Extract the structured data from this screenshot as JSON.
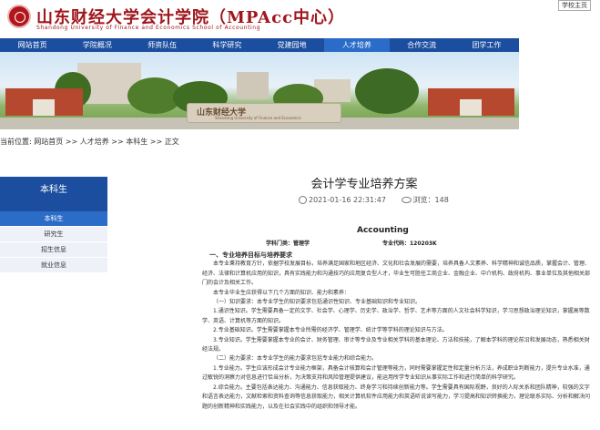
{
  "header": {
    "title": "山东财经大学会计学院（MPAcc中心）",
    "subtitle": "Shandong University of Finance and Economics School of Accounting",
    "top_link": "学校主页"
  },
  "nav": [
    "网站首页",
    "学院概况",
    "师资队伍",
    "科学研究",
    "党建园地",
    "人才培养",
    "合作交流",
    "团学工作"
  ],
  "banner": {
    "stone_text": "山东财经大学",
    "stone_sub": "Shandong University of Finance and Economics"
  },
  "breadcrumb": "当前位置: 网站首页 >> 人才培养 >> 本科生 >> 正文",
  "sidebar": {
    "title": "本科生",
    "items": [
      "本科生",
      "研究生",
      "招生信息",
      "就业信息"
    ]
  },
  "article": {
    "title": "会计学专业培养方案",
    "date": "2021-01-16 22:31:47",
    "views_label": "浏览：",
    "views": "148",
    "heading": "Accounting",
    "subject": "学科门类：管理学",
    "code": "专业代码：120203K",
    "paragraphs": [
      {
        "type": "h",
        "text": "一、专业培养目标与培养要求"
      },
      {
        "type": "p",
        "text": "本专业秉持教育方针，依据学校发展目标，培养满足国家和地区经济、文化和社会发展的需要，培养具备人文素养、科学精神和诚信品质，掌握会计、管理、经济、法律和计算机应用的知识，具有实践能力和沟通技巧的应用复合型人才，毕业生可胜任工商企业、金融企业、中介机构、政府机构、事业单位及其他相关部门的会计及相关工作。"
      },
      {
        "type": "p",
        "text": "本专业毕业生应获得以下几个方面的知识、能力和素养："
      },
      {
        "type": "p",
        "text": "（一）知识要求：本专业学生的知识要求包括通识性知识、专业基础知识和专业知识。"
      },
      {
        "type": "p",
        "text": "1.通识性知识。学生需要具备一定的文学、社会学、心理学、历史学、政治学、哲学、艺术等方面的人文社会科学知识，学习思想政治理论知识，掌握高等数学、英语、计算机等方面的知识。"
      },
      {
        "type": "p",
        "text": "2.专业基础知识。学生需要掌握本专业所需的经济学、管理学、统计学等学科的理论知识与方法。"
      },
      {
        "type": "p",
        "text": "3.专业知识。学生需要掌握本专业的会计、财务管理、审计等专业及专业相关学科的基本理论、方法和技能，了解本学科的理论前沿和发展动态，熟悉相关财经法规。"
      },
      {
        "type": "p",
        "text": "（二）能力要求：本专业学生的能力要求包括专业能力和综合能力。"
      },
      {
        "type": "p",
        "text": "1.专业能力。学生应该形成会计专业能力框架，具备会计核算和会计管理等能力，同时需要掌握定性和定量分析方法，养成职业判断能力，提升专业水准，通过敏锐的洞察力对信息进行恰当分析，为决策支持和风险管理提供建议，能运用所学专业知识从事实际工作和进行简单的科学研究。"
      },
      {
        "type": "p",
        "text": "2.综合能力。主要包括表达能力、沟通能力、信息获取能力、终身学习和持续创新能力等。学生需要具有国际视野，良好的人际关系和团队精神，较强的文字和语言表达能力，文献检索和资料查询等信息获取能力，相关计算机软件应用能力和英语听说读写能力，学习提高和知识转换能力，理论联系实际、分析和解决问题的创新精神和实践能力，以及在社会实践中的组织和领导才能。"
      }
    ]
  },
  "colors": {
    "nav_blue": "#1b4e9f",
    "active_blue": "#2b6cc8",
    "brand_red": "#a0161c"
  }
}
